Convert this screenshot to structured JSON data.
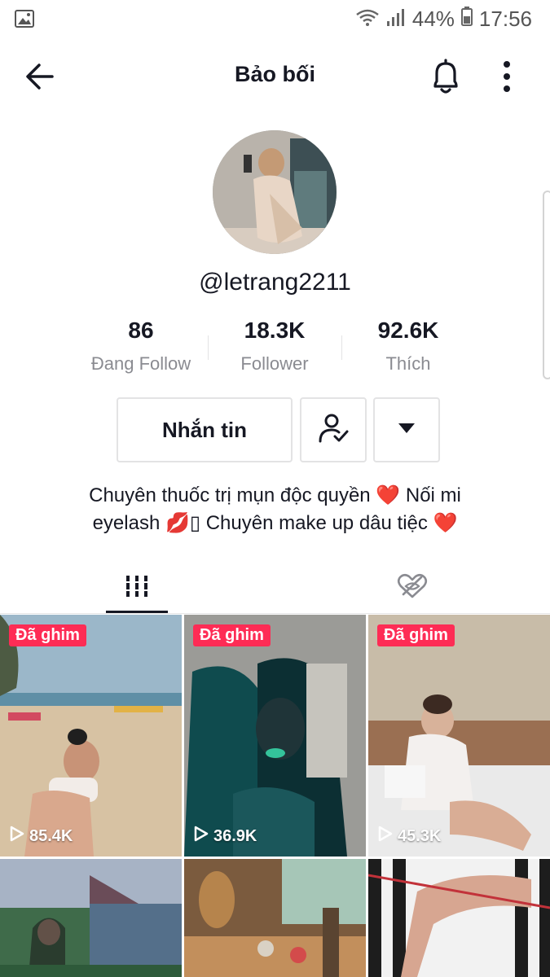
{
  "status_bar": {
    "battery": "44%",
    "time": "17:56",
    "icons": [
      "gallery-icon",
      "wifi-icon",
      "signal-icon",
      "battery-icon"
    ]
  },
  "header": {
    "title": "Bảo bối",
    "icons": [
      "back-arrow-icon",
      "bell-icon",
      "more-vertical-icon"
    ]
  },
  "profile": {
    "handle": "@letrang2211",
    "stats": [
      {
        "value": "86",
        "label": "Đang Follow"
      },
      {
        "value": "18.3K",
        "label": "Follower"
      },
      {
        "value": "92.6K",
        "label": "Thích"
      }
    ],
    "message_label": "Nhắn tin",
    "bio_line1": "Chuyên thuốc trị mụn độc quyền ❤️ Nối mi",
    "bio_line2": "eyelash 💋▯ Chuyên make up dâu tiệc ❤️"
  },
  "tabs": [
    {
      "icon": "grid-icon",
      "active": true
    },
    {
      "icon": "liked-hidden-icon",
      "active": false
    }
  ],
  "videos": [
    {
      "pinned": "Đã ghim",
      "views": "85.4K"
    },
    {
      "pinned": "Đã ghim",
      "views": "36.9K"
    },
    {
      "pinned": "Đã ghim",
      "views": "45.3K"
    },
    {
      "pinned": "",
      "views": ""
    },
    {
      "pinned": "",
      "views": ""
    },
    {
      "pinned": "",
      "views": ""
    }
  ],
  "colors": {
    "accent": "#fe2c55",
    "text": "#161823",
    "muted": "#8a8b91",
    "border": "#e3e3e4"
  }
}
